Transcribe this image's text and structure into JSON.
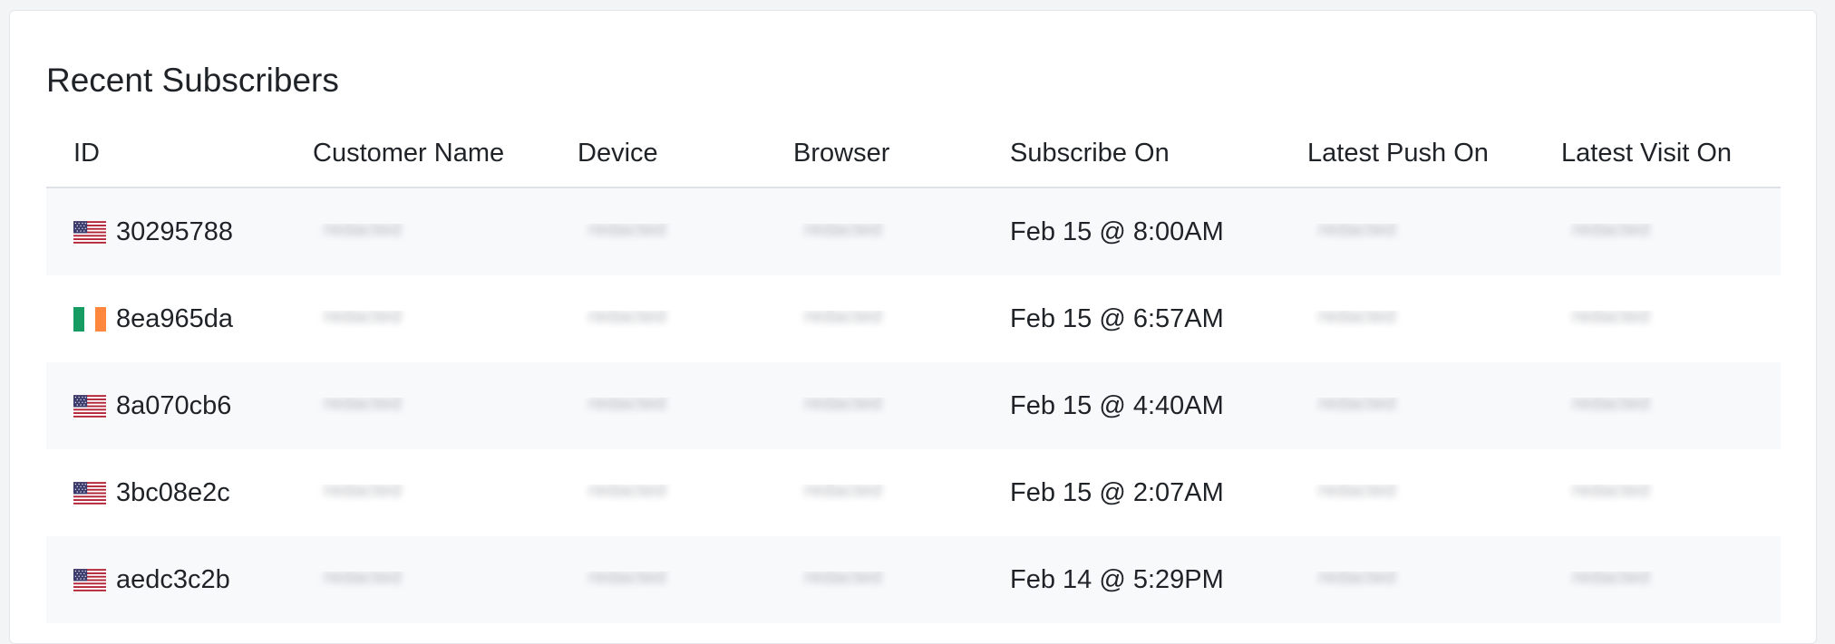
{
  "card": {
    "title": "Recent Subscribers"
  },
  "table": {
    "columns": [
      "ID",
      "Customer Name",
      "Device",
      "Browser",
      "Subscribe On",
      "Latest Push On",
      "Latest Visit On"
    ],
    "rows": [
      {
        "flag": "us-flag-icon",
        "id": "30295788",
        "customer_name": "redacted",
        "device": "redacted",
        "browser": "redacted",
        "subscribe_on": "Feb 15 @ 8:00AM",
        "latest_push_on": "redacted",
        "latest_visit_on": "redacted"
      },
      {
        "flag": "ie-flag-icon",
        "id": "8ea965da",
        "customer_name": "redacted",
        "device": "redacted",
        "browser": "redacted",
        "subscribe_on": "Feb 15 @ 6:57AM",
        "latest_push_on": "redacted",
        "latest_visit_on": "redacted"
      },
      {
        "flag": "us-flag-icon",
        "id": "8a070cb6",
        "customer_name": "redacted",
        "device": "redacted",
        "browser": "redacted",
        "subscribe_on": "Feb 15 @ 4:40AM",
        "latest_push_on": "redacted",
        "latest_visit_on": "redacted"
      },
      {
        "flag": "us-flag-icon",
        "id": "3bc08e2c",
        "customer_name": "redacted",
        "device": "redacted",
        "browser": "redacted",
        "subscribe_on": "Feb 15 @ 2:07AM",
        "latest_push_on": "redacted",
        "latest_visit_on": "redacted"
      },
      {
        "flag": "us-flag-icon",
        "id": "aedc3c2b",
        "customer_name": "redacted",
        "device": "redacted",
        "browser": "redacted",
        "subscribe_on": "Feb 14 @ 5:29PM",
        "latest_push_on": "redacted",
        "latest_visit_on": "redacted"
      }
    ]
  }
}
